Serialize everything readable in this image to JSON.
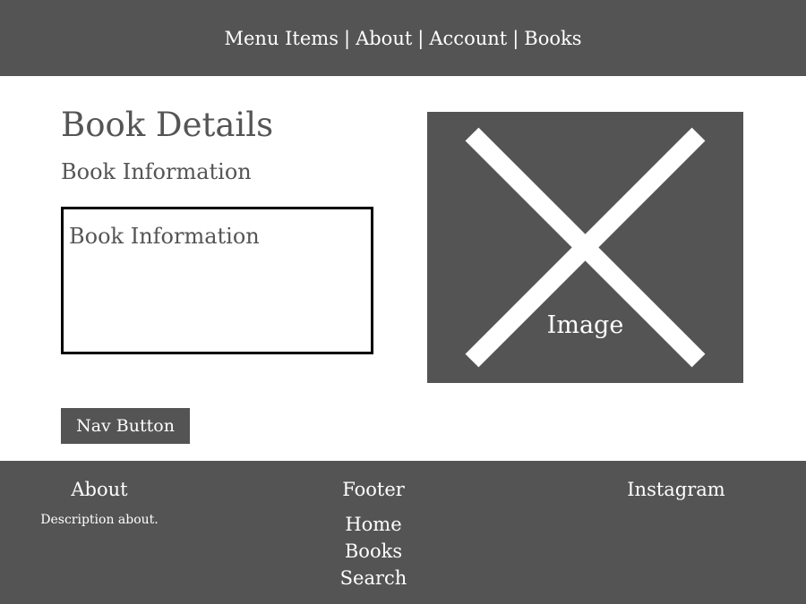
{
  "header": {
    "nav": [
      {
        "label": "Menu Items"
      },
      {
        "label": "About"
      },
      {
        "label": "Account"
      },
      {
        "label": "Books"
      }
    ],
    "separator": "|"
  },
  "main": {
    "title": "Book Details",
    "subtitle": "Book Information",
    "info_box_text": "Book Information",
    "image_label": "Image",
    "nav_button_label": "Nav Button"
  },
  "footer": {
    "about_title": "About",
    "about_description": "Description about.",
    "center_title": "Footer",
    "links": [
      "Home",
      "Books",
      "Search"
    ],
    "instagram": "Instagram"
  },
  "colors": {
    "dark_gray": "#545454",
    "text_gray": "#555555",
    "white": "#ffffff",
    "border_black": "#000000"
  },
  "icons": {
    "image_placeholder": "image-placeholder-icon"
  }
}
